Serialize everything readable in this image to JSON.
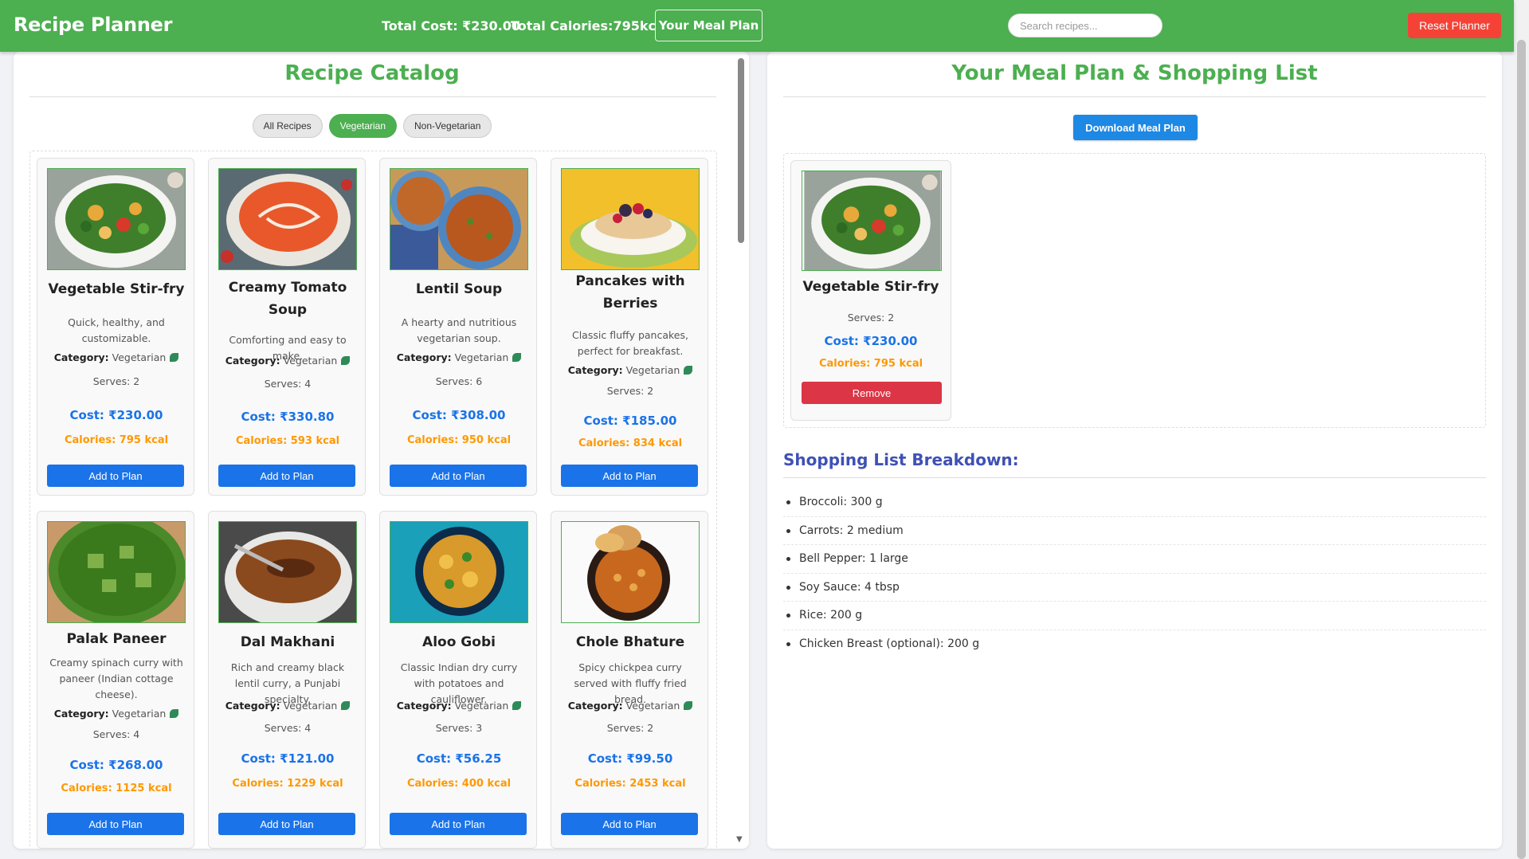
{
  "header": {
    "title": "Recipe Planner",
    "total_cost": "Total Cost: ₹230.00",
    "total_calories": "Total Calories:795kcal",
    "meal_plan_button": "Your Meal Plan",
    "search_placeholder": "Search recipes...",
    "reset_button": "Reset Planner"
  },
  "catalog": {
    "title": "Recipe Catalog",
    "filters": [
      {
        "label": "All Recipes",
        "active": false
      },
      {
        "label": "Vegetarian",
        "active": true
      },
      {
        "label": "Non-Vegetarian",
        "active": false
      }
    ],
    "category_label": "Category:",
    "add_label": "Add to Plan",
    "recipes": [
      {
        "title": "Vegetable Stir-fry",
        "desc": "Quick, healthy, and customizable.",
        "category": "Vegetarian",
        "serves": "Serves: 2",
        "cost": "Cost: ₹230.00",
        "calories": "Calories: 795 kcal",
        "image": "salad-bowl"
      },
      {
        "title": "Creamy Tomato Soup",
        "desc": "Comforting and easy to make.",
        "category": "Vegetarian",
        "serves": "Serves: 4",
        "cost": "Cost: ₹330.80",
        "calories": "Calories: 593 kcal",
        "image": "tomato-soup"
      },
      {
        "title": "Lentil Soup",
        "desc": "A hearty and nutritious vegetarian soup.",
        "category": "Vegetarian",
        "serves": "Serves: 6",
        "cost": "Cost: ₹308.00",
        "calories": "Calories: 950 kcal",
        "image": "lentil-soup"
      },
      {
        "title": "Pancakes with Berries",
        "desc": "Classic fluffy pancakes, perfect for breakfast.",
        "category": "Vegetarian",
        "serves": "Serves: 2",
        "cost": "Cost: ₹185.00",
        "calories": "Calories: 834 kcal",
        "image": "pancakes"
      },
      {
        "title": "Palak Paneer",
        "desc": "Creamy spinach curry with paneer (Indian cottage cheese).",
        "category": "Vegetarian",
        "serves": "Serves: 4",
        "cost": "Cost: ₹268.00",
        "calories": "Calories: 1125 kcal",
        "image": "palak-paneer"
      },
      {
        "title": "Dal Makhani",
        "desc": "Rich and creamy black lentil curry, a Punjabi specialty.",
        "category": "Vegetarian",
        "serves": "Serves: 4",
        "cost": "Cost: ₹121.00",
        "calories": "Calories: 1229 kcal",
        "image": "dal-makhani"
      },
      {
        "title": "Aloo Gobi",
        "desc": "Classic Indian dry curry with potatoes and cauliflower.",
        "category": "Vegetarian",
        "serves": "Serves: 3",
        "cost": "Cost: ₹56.25",
        "calories": "Calories: 400 kcal",
        "image": "aloo-gobi"
      },
      {
        "title": "Chole Bhature",
        "desc": "Spicy chickpea curry served with fluffy fried bread.",
        "category": "Vegetarian",
        "serves": "Serves: 2",
        "cost": "Cost: ₹99.50",
        "calories": "Calories: 2453 kcal",
        "image": "chole-bhature"
      }
    ]
  },
  "plan": {
    "title": "Your Meal Plan & Shopping List",
    "download_button": "Download Meal Plan",
    "items": [
      {
        "title": "Vegetable Stir-fry",
        "serves": "Serves: 2",
        "cost": "Cost: ₹230.00",
        "calories": "Calories: 795 kcal",
        "remove_label": "Remove",
        "image": "salad-bowl"
      }
    ],
    "shopping_title": "Shopping List Breakdown:",
    "shopping_list": [
      "Broccoli: 300 g",
      "Carrots: 2 medium",
      "Bell Pepper: 1 large",
      "Soy Sauce: 4 tbsp",
      "Rice: 200 g",
      "Chicken Breast (optional): 200 g"
    ]
  },
  "colors": {
    "brand": "#4caf50",
    "primary": "#1a73e8",
    "danger": "#f44336",
    "calories": "#ff9800",
    "shopping_title": "#3f51b5"
  }
}
